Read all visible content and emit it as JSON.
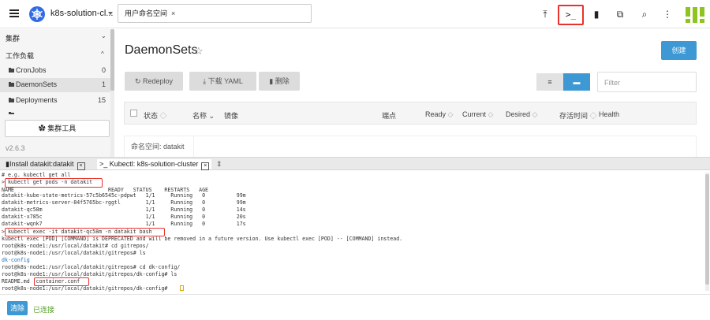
{
  "header": {
    "cluster_name": "k8s-solution-cl...",
    "namespace_chip": "用户命名空间",
    "chip_close": "×",
    "icons": [
      "upload-icon",
      "kubectl-shell-icon",
      "file-icon",
      "import-icon",
      "search-icon",
      "more-vert-icon"
    ],
    "shell_glyph": ">_"
  },
  "sidebar": {
    "groups": [
      {
        "label": "集群",
        "chevron": "⌄"
      },
      {
        "label": "工作负载",
        "chevron": "^"
      }
    ],
    "items": [
      {
        "label": "CronJobs",
        "count": "0"
      },
      {
        "label": "DaemonSets",
        "count": "1"
      },
      {
        "label": "Deployments",
        "count": "15"
      }
    ],
    "cluster_tools": "集群工具",
    "version": "v2.6.3"
  },
  "main": {
    "title": "DaemonSets",
    "create_label": "创建",
    "redeploy_label": "Redeploy",
    "download_label": "下载 YAML",
    "delete_label": "删除",
    "filter_placeholder": "Filter",
    "columns": [
      "状态",
      "名称",
      "镜像",
      "端点",
      "Ready",
      "Current",
      "Desired",
      "存活时间",
      "Health"
    ],
    "namespace_label": "命名空间:  datakit"
  },
  "terminal": {
    "tabs": [
      {
        "label": "Install datakit:datakit",
        "close": "×"
      },
      {
        "label": "Kubectl: k8s-solution-cluster",
        "close": "×"
      }
    ],
    "lines": [
      {
        "text": "# e.g. kubectl get all",
        "style": "normal"
      },
      {
        "text": "> kubectl get pods -n datakit",
        "style": "normal"
      },
      {
        "text": "NAME                              READY   STATUS    RESTARTS   AGE",
        "style": "normal"
      },
      {
        "text": "datakit-kube-state-metrics-57c5b6545c-pdpwt   1/1     Running   0          99m",
        "style": "normal"
      },
      {
        "text": "datakit-metrics-server-84f5765bc-rggtl        1/1     Running   0          99m",
        "style": "normal"
      },
      {
        "text": "datakit-qc58m                                 1/1     Running   0          14s",
        "style": "normal"
      },
      {
        "text": "datakit-x785c                                 1/1     Running   0          20s",
        "style": "normal"
      },
      {
        "text": "datakit-wqnk7                                 1/1     Running   0          17s",
        "style": "normal"
      },
      {
        "text": "> kubectl exec -it datakit-qc58m -n datakit bash",
        "style": "normal"
      },
      {
        "text": "kubectl exec [POD] [COMMAND] is DEPRECATED and will be removed in a future version. Use kubectl exec [POD] -- [COMMAND] instead.",
        "style": "normal"
      },
      {
        "text": "root@k8s-node1:/usr/local/datakit# cd gitrepos/",
        "style": "normal"
      },
      {
        "text": "root@k8s-node1:/usr/local/datakit/gitrepos# ls",
        "style": "normal"
      },
      {
        "text": "dk-config",
        "style": "blue"
      },
      {
        "text": "root@k8s-node1:/usr/local/datakit/gitrepos# cd dk-config/",
        "style": "normal"
      },
      {
        "text": "root@k8s-node1:/usr/local/datakit/gitrepos/dk-config# ls",
        "style": "normal"
      },
      {
        "text": "README.md  container.conf",
        "style": "normal"
      },
      {
        "text": "root@k8s-node1:/usr/local/datakit/gitrepos/dk-config# ",
        "style": "normal"
      }
    ]
  },
  "bottom": {
    "clear_label": "清除",
    "status": "已连接"
  },
  "colors": {
    "accent": "#3d98d3",
    "highlight_box": "#e8322d",
    "connected": "#5aa02c",
    "logo_green": "#8fc31f"
  }
}
